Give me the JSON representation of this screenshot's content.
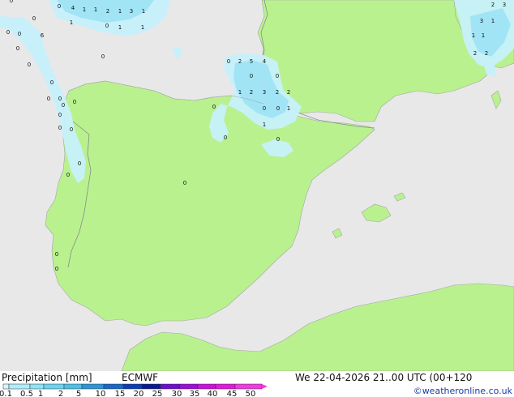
{
  "title": "Precipitation [mm]",
  "model": "ECMWF",
  "valid_time": "We 22-04-2026 21..00 UTC (00+120",
  "credit": "©weatheronline.co.uk",
  "legend": {
    "ticks": [
      "0.1",
      "0.5",
      "1",
      "2",
      "5",
      "10",
      "15",
      "20",
      "25",
      "30",
      "35",
      "40",
      "45",
      "50"
    ],
    "colors": [
      "#d6f5ff",
      "#b0ecfb",
      "#8ee2f6",
      "#6dd3ef",
      "#4dc0e6",
      "#2d94d6",
      "#1a68c4",
      "#0c3eb0",
      "#0a1c8c",
      "#6a10c8",
      "#9a10d8",
      "#c812d8",
      "#e01ad8",
      "#f03ae0"
    ]
  },
  "colors": {
    "land": "#b9f18f",
    "sea": "#e8e8e8",
    "border": "#8a8a8a",
    "coast": "#a4a4a4",
    "precip_light": "#c6f0fb",
    "precip_mid": "#9fe3f6",
    "precip_strong": "#72cdee"
  },
  "precip_labels": [
    "0",
    "4",
    "1",
    "1",
    "2",
    "1",
    "3",
    "1",
    "1",
    "0",
    "1",
    "1",
    "0",
    "0",
    "0",
    "0",
    "6",
    "0",
    "0",
    "0",
    "0",
    "0",
    "2",
    "5",
    "4",
    "0",
    "0",
    "1",
    "2",
    "3",
    "2",
    "2",
    "0",
    "0",
    "1",
    "0",
    "1",
    "0",
    "0",
    "0",
    "0",
    "0",
    "0",
    "0",
    "0",
    "0",
    "0",
    "0",
    "0",
    "2",
    "3",
    "3",
    "1",
    "1",
    "1",
    "2",
    "2",
    "0",
    "0"
  ]
}
